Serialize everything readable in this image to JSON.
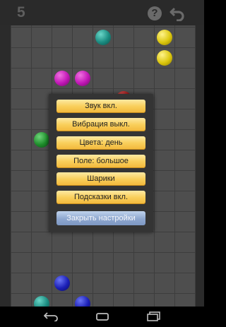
{
  "header": {
    "score": "5"
  },
  "board": {
    "balls": [
      {
        "color": "teal",
        "row": 0,
        "col": 4
      },
      {
        "color": "yellow",
        "row": 0,
        "col": 7
      },
      {
        "color": "yellow",
        "row": 1,
        "col": 7
      },
      {
        "color": "magenta",
        "row": 2,
        "col": 2
      },
      {
        "color": "magenta",
        "row": 2,
        "col": 3
      },
      {
        "color": "red",
        "row": 3,
        "col": 5
      },
      {
        "color": "green",
        "row": 5,
        "col": 1
      },
      {
        "color": "blue",
        "row": 12,
        "col": 2
      },
      {
        "color": "teal",
        "row": 13,
        "col": 1
      },
      {
        "color": "blue",
        "row": 13,
        "col": 3
      }
    ]
  },
  "settings": {
    "options": [
      "Звук вкл.",
      "Вибрация выкл.",
      "Цвета: день",
      "Поле: большое",
      "Шарики",
      "Подсказки вкл."
    ],
    "close_label": "Закрыть настройки"
  }
}
